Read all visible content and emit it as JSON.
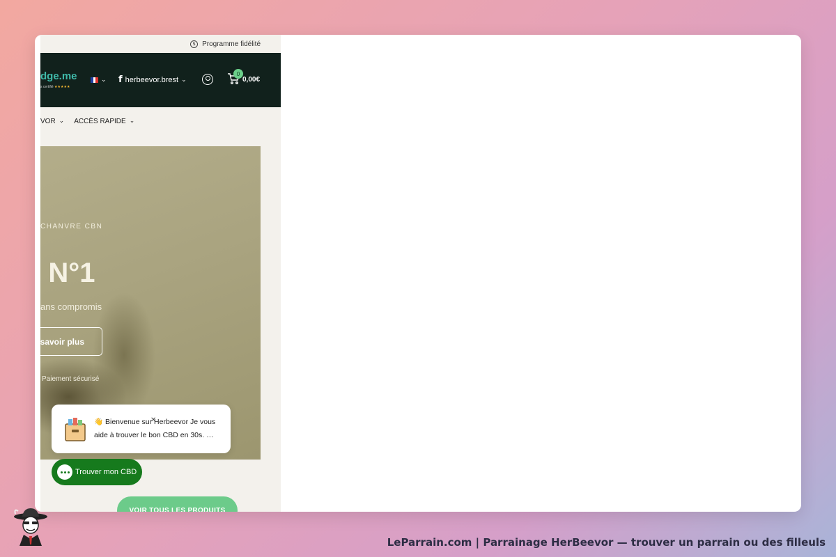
{
  "topbar": {
    "loyalty_icon": "coin-icon",
    "loyalty_label": "Programme fidélité"
  },
  "header": {
    "logo_text": "dge.me",
    "logo_sub": "s certifié",
    "logo_stars": "★★★★★",
    "language_flag": "france-flag-icon",
    "facebook_label": "herbeevor.brest",
    "account_icon": "user-icon",
    "cart_icon": "cart-icon",
    "cart_count": "0",
    "cart_total": "0,00€"
  },
  "nav": {
    "items": [
      {
        "label": "VOR"
      },
      {
        "label": "ACCÈS RAPIDE"
      }
    ]
  },
  "hero": {
    "eyebrow": "CHANVRE CBN",
    "title": "e N°1",
    "subtitle": "ans compromis",
    "button_label": "savoir plus",
    "secure_label": "Paiement sécurisé"
  },
  "chat": {
    "message": "👋 Bienvenue sur Herbeevor Je vous aide à trouver le bon CBD en 30s. …",
    "close_glyph": "✕",
    "button_label": "Trouver mon CBD"
  },
  "products_button": "VOIR TOUS LES PRODUITS",
  "footer": {
    "caption": "LeParrain.com | Parrainage HerBeevor — trouver un parrain ou des filleuls"
  },
  "colors": {
    "header_bg": "#11211c",
    "logo": "#3fb8a8",
    "chat_button": "#167a1d",
    "products_button": "#6ccb8a",
    "page_bg": "#f3f1ec"
  }
}
